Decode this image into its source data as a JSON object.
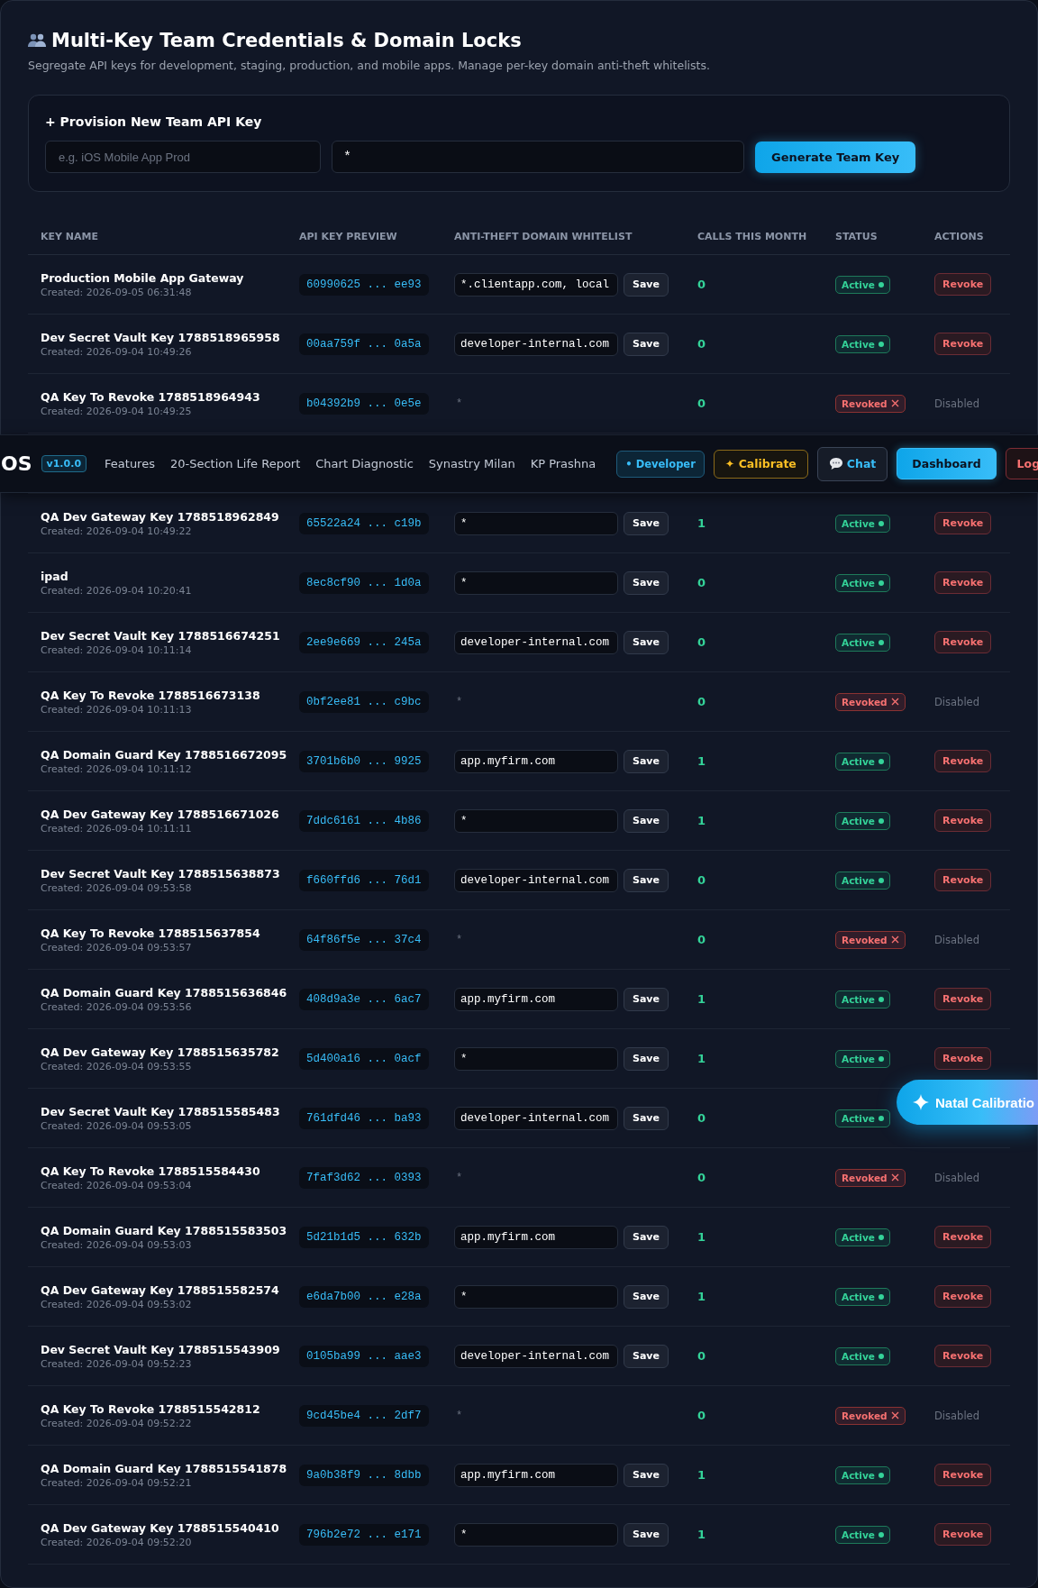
{
  "panel": {
    "title": "Multi-Key Team Credentials & Domain Locks",
    "subtitle": "Segregate API keys for development, staging, production, and mobile apps. Manage per-key domain anti-theft whitelists."
  },
  "provision": {
    "title": "+ Provision New Team API Key",
    "name_field": {
      "placeholder": "e.g. iOS Mobile App Prod"
    },
    "domain_field": {
      "value": "*"
    },
    "button": "Generate Team Key"
  },
  "table": {
    "columns": [
      "KEY NAME",
      "API KEY PREVIEW",
      "ANTI-THEFT DOMAIN WHITELIST",
      "CALLS THIS MONTH",
      "STATUS",
      "ACTIONS"
    ],
    "rows": [
      {
        "name": "Production Mobile App Gateway",
        "created": "Created: 2026-09-05 06:31:48",
        "key": "60990625 ... ee93",
        "whitelist": "*.clientapp.com, local",
        "save": "Save",
        "calls": "0",
        "kind": "active",
        "status_label": "Active",
        "action": "Revoke"
      },
      {
        "name": "Dev Secret Vault Key 1788518965958",
        "created": "Created: 2026-09-04 10:49:26",
        "key": "00aa759f ... 0a5a",
        "whitelist": "developer-internal.com",
        "save": "Save",
        "calls": "0",
        "kind": "active",
        "status_label": "Active",
        "action": "Revoke"
      },
      {
        "name": "QA Key To Revoke 1788518964943",
        "created": "Created: 2026-09-04 10:49:25",
        "key": "b04392b9 ... 0e5e",
        "whitelist": "*",
        "calls": "0",
        "kind": "revoked",
        "status_label": "Revoked",
        "action": "Disabled"
      },
      {
        "name": "QA Dev Gateway Key 1788518962849",
        "created": "Created: 2026-09-04 10:49:22",
        "key": "65522a24 ... c19b",
        "whitelist": "*",
        "save": "Save",
        "calls": "1",
        "kind": "active",
        "status_label": "Active",
        "action": "Revoke"
      },
      {
        "name": "ipad",
        "created": "Created: 2026-09-04 10:20:41",
        "key": "8ec8cf90 ... 1d0a",
        "whitelist": "*",
        "save": "Save",
        "calls": "0",
        "kind": "active",
        "status_label": "Active",
        "action": "Revoke"
      },
      {
        "name": "Dev Secret Vault Key 1788516674251",
        "created": "Created: 2026-09-04 10:11:14",
        "key": "2ee9e669 ... 245a",
        "whitelist": "developer-internal.com",
        "save": "Save",
        "calls": "0",
        "kind": "active",
        "status_label": "Active",
        "action": "Revoke"
      },
      {
        "name": "QA Key To Revoke 1788516673138",
        "created": "Created: 2026-09-04 10:11:13",
        "key": "0bf2ee81 ... c9bc",
        "whitelist": "*",
        "calls": "0",
        "kind": "revoked",
        "status_label": "Revoked",
        "action": "Disabled"
      },
      {
        "name": "QA Domain Guard Key 1788516672095",
        "created": "Created: 2026-09-04 10:11:12",
        "key": "3701b6b0 ... 9925",
        "whitelist": "app.myfirm.com",
        "save": "Save",
        "calls": "1",
        "kind": "active",
        "status_label": "Active",
        "action": "Revoke"
      },
      {
        "name": "QA Dev Gateway Key 1788516671026",
        "created": "Created: 2026-09-04 10:11:11",
        "key": "7ddc6161 ... 4b86",
        "whitelist": "*",
        "save": "Save",
        "calls": "1",
        "kind": "active",
        "status_label": "Active",
        "action": "Revoke"
      },
      {
        "name": "Dev Secret Vault Key 1788515638873",
        "created": "Created: 2026-09-04 09:53:58",
        "key": "f660ffd6 ... 76d1",
        "whitelist": "developer-internal.com",
        "save": "Save",
        "calls": "0",
        "kind": "active",
        "status_label": "Active",
        "action": "Revoke"
      },
      {
        "name": "QA Key To Revoke 1788515637854",
        "created": "Created: 2026-09-04 09:53:57",
        "key": "64f86f5e ... 37c4",
        "whitelist": "*",
        "calls": "0",
        "kind": "revoked",
        "status_label": "Revoked",
        "action": "Disabled"
      },
      {
        "name": "QA Domain Guard Key 1788515636846",
        "created": "Created: 2026-09-04 09:53:56",
        "key": "408d9a3e ... 6ac7",
        "whitelist": "app.myfirm.com",
        "save": "Save",
        "calls": "1",
        "kind": "active",
        "status_label": "Active",
        "action": "Revoke"
      },
      {
        "name": "QA Dev Gateway Key 1788515635782",
        "created": "Created: 2026-09-04 09:53:55",
        "key": "5d400a16 ... 0acf",
        "whitelist": "*",
        "save": "Save",
        "calls": "1",
        "kind": "active",
        "status_label": "Active",
        "action": "Revoke"
      },
      {
        "name": "Dev Secret Vault Key 1788515585483",
        "created": "Created: 2026-09-04 09:53:05",
        "key": "761dfd46 ... ba93",
        "whitelist": "developer-internal.com",
        "save": "Save",
        "calls": "0",
        "kind": "active",
        "status_label": "Active"
      },
      {
        "name": "QA Key To Revoke 1788515584430",
        "created": "Created: 2026-09-04 09:53:04",
        "key": "7faf3d62 ... 0393",
        "whitelist": "*",
        "calls": "0",
        "kind": "revoked",
        "status_label": "Revoked",
        "action": "Disabled"
      },
      {
        "name": "QA Domain Guard Key 1788515583503",
        "created": "Created: 2026-09-04 09:53:03",
        "key": "5d21b1d5 ... 632b",
        "whitelist": "app.myfirm.com",
        "save": "Save",
        "calls": "1",
        "kind": "active",
        "status_label": "Active",
        "action": "Revoke"
      },
      {
        "name": "QA Dev Gateway Key 1788515582574",
        "created": "Created: 2026-09-04 09:53:02",
        "key": "e6da7b00 ... e28a",
        "whitelist": "*",
        "save": "Save",
        "calls": "1",
        "kind": "active",
        "status_label": "Active",
        "action": "Revoke"
      },
      {
        "name": "Dev Secret Vault Key 1788515543909",
        "created": "Created: 2026-09-04 09:52:23",
        "key": "0105ba99 ... aae3",
        "whitelist": "developer-internal.com",
        "save": "Save",
        "calls": "0",
        "kind": "active",
        "status_label": "Active",
        "action": "Revoke"
      },
      {
        "name": "QA Key To Revoke 1788515542812",
        "created": "Created: 2026-09-04 09:52:22",
        "key": "9cd45be4 ... 2df7",
        "whitelist": "*",
        "calls": "0",
        "kind": "revoked",
        "status_label": "Revoked",
        "action": "Disabled"
      },
      {
        "name": "QA Domain Guard Key 1788515541878",
        "created": "Created: 2026-09-04 09:52:21",
        "key": "9a0b38f9 ... 8dbb",
        "whitelist": "app.myfirm.com",
        "save": "Save",
        "calls": "1",
        "kind": "active",
        "status_label": "Active",
        "action": "Revoke"
      },
      {
        "name": "QA Dev Gateway Key 1788515540410",
        "created": "Created: 2026-09-04 09:52:20",
        "key": "796b2e72 ... e171",
        "whitelist": "*",
        "save": "Save",
        "calls": "1",
        "kind": "active",
        "status_label": "Active",
        "action": "Revoke"
      }
    ]
  },
  "navbar": {
    "logo": "OS",
    "version": "v1.0.0",
    "links": [
      "Features",
      "20-Section Life Report",
      "Chart Diagnostic",
      "Synastry Milan",
      "KP Prashna"
    ],
    "buttons": [
      {
        "kind": "role",
        "label": "• Developer"
      },
      {
        "kind": "calibrate",
        "label": "✦ Calibrate"
      },
      {
        "kind": "chat",
        "label": "Chat"
      },
      {
        "kind": "primary",
        "label": "Dashboard"
      },
      {
        "kind": "danger",
        "label": "Log"
      }
    ]
  },
  "floating_button": {
    "label": "Natal Calibratio"
  }
}
